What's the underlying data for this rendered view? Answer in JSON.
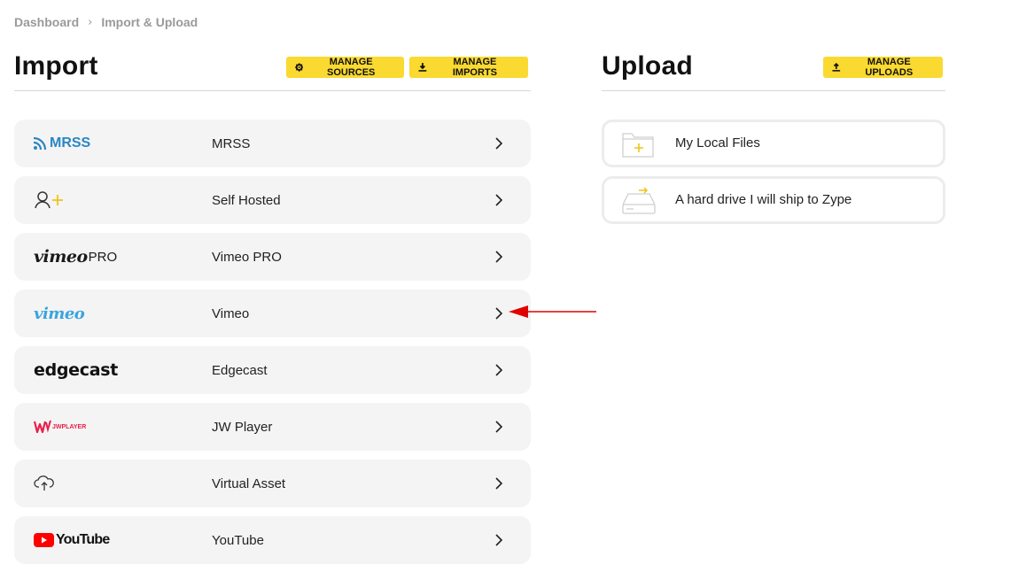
{
  "breadcrumb": {
    "items": [
      "Dashboard",
      "Import & Upload"
    ]
  },
  "import": {
    "title": "Import",
    "manage_sources_label": "MANAGE SOURCES",
    "manage_imports_label": "MANAGE IMPORTS",
    "sources": [
      {
        "label": "MRSS",
        "logo_text": "MRSS",
        "icon": "rss-icon"
      },
      {
        "label": "Self Hosted",
        "icon": "user-add-icon"
      },
      {
        "label": "Vimeo PRO",
        "logo_text": "vimeo",
        "logo_suffix": "PRO",
        "icon": "vimeo-pro-logo"
      },
      {
        "label": "Vimeo",
        "logo_text": "vimeo",
        "icon": "vimeo-logo"
      },
      {
        "label": "Edgecast",
        "logo_text": "edgecast",
        "icon": "edgecast-logo"
      },
      {
        "label": "JW Player",
        "logo_text": "JWPLAYER",
        "icon": "jwplayer-logo"
      },
      {
        "label": "Virtual Asset",
        "icon": "cloud-upload-icon"
      },
      {
        "label": "YouTube",
        "logo_text": "YouTube",
        "icon": "youtube-logo"
      }
    ]
  },
  "upload": {
    "title": "Upload",
    "manage_uploads_label": "MANAGE UPLOADS",
    "options": [
      {
        "label": "My Local Files",
        "icon": "folder-add-icon"
      },
      {
        "label": "A hard drive I will ship to Zype",
        "icon": "hard-drive-icon"
      }
    ]
  },
  "colors": {
    "accent": "#fad930",
    "row_bg": "#f4f4f4",
    "annotation_arrow": "#e00000"
  }
}
